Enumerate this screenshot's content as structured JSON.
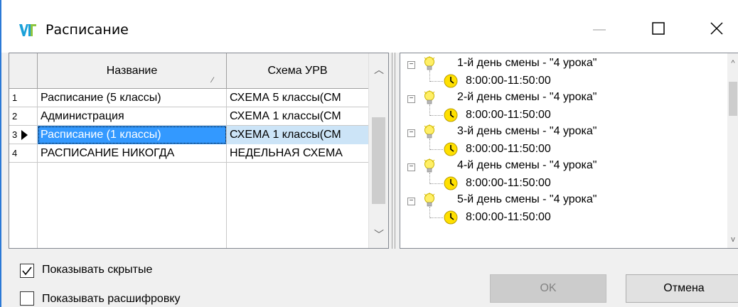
{
  "window": {
    "title": "Расписание"
  },
  "grid": {
    "columns": [
      {
        "label": "Название"
      },
      {
        "label": "Схема УРВ"
      }
    ],
    "rows": [
      {
        "num": "1",
        "name": "Расписание (5 классы)",
        "schema": "СХЕМА 5 классы(СМ"
      },
      {
        "num": "2",
        "name": "Администрация",
        "schema": "СХЕМА 1 классы(СМ"
      },
      {
        "num": "3",
        "name": "Расписание (1 классы)",
        "schema": "СХЕМА 1 классы(СМ"
      },
      {
        "num": "4",
        "name": " РАСПИСАНИЕ НИКОГДА",
        "schema": "НЕДЕЛЬНАЯ СХЕМА"
      }
    ],
    "selected_row": 3
  },
  "tree": {
    "items": [
      {
        "day": "1-й день смены - \"4 урока\"",
        "time": "8:00:00-11:50:00"
      },
      {
        "day": "2-й день смены - \"4 урока\"",
        "time": "8:00:00-11:50:00"
      },
      {
        "day": "3-й день смены - \"4 урока\"",
        "time": "8:00:00-11:50:00"
      },
      {
        "day": "4-й день смены - \"4 урока\"",
        "time": "8:00:00-11:50:00"
      },
      {
        "day": "5-й день смены - \"4 урока\"",
        "time": "8:00:00-11:50:00"
      }
    ]
  },
  "options": {
    "show_hidden": {
      "label": "Показывать скрытые",
      "checked": true
    },
    "show_decoding": {
      "label": "Показывать расшифровку",
      "checked": false
    }
  },
  "buttons": {
    "ok": "OK",
    "cancel": "Отмена"
  },
  "colors": {
    "accent": "#2b79d6",
    "selection": "#3399ff",
    "selection_light": "#cce4f7"
  }
}
